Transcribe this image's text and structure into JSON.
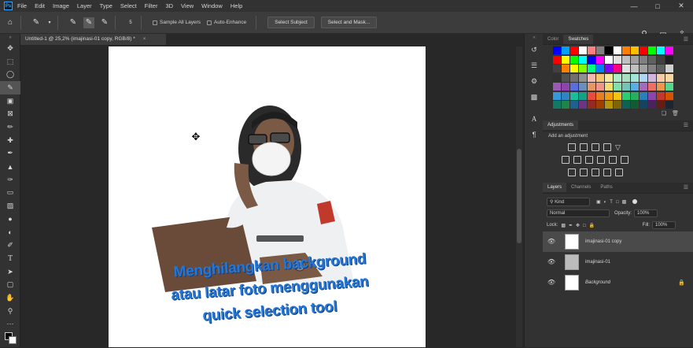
{
  "menubar": {
    "logo": "Ps",
    "items": [
      "File",
      "Edit",
      "Image",
      "Layer",
      "Type",
      "Select",
      "Filter",
      "3D",
      "View",
      "Window",
      "Help"
    ]
  },
  "options": {
    "sample_all_layers": "Sample All Layers",
    "auto_enhance": "Auto-Enhance",
    "select_subject": "Select Subject",
    "select_and_mask": "Select and Mask...",
    "brush_size": "5"
  },
  "document": {
    "tab_title": "Untitled-1 @ 25,2% (imajinasi-01 copy, RGB/8) *",
    "caption_lines": [
      "Menghilangkan background",
      "atau latar foto menggunakan",
      "quick selection tool"
    ]
  },
  "panels": {
    "swatch_tabs": [
      "Color",
      "Swatches"
    ],
    "active_swatch_tab": "Swatches",
    "adjustments_tab": "Adjustments",
    "add_adjustment": "Add an adjustment",
    "layer_tabs": [
      "Layers",
      "Channels",
      "Paths"
    ],
    "kind": "Kind",
    "blend_mode": "Normal",
    "opacity_label": "Opacity:",
    "opacity": "100%",
    "lock_label": "Lock:",
    "fill_label": "Fill:",
    "fill": "100%",
    "layers": [
      "imajinasi-01 copy",
      "imajinasi-01",
      "Background"
    ]
  },
  "colors": {
    "accent_blue": "#2477d6",
    "selected_layer": "#4a4a4a",
    "ps_logo": "#31a8ff"
  }
}
